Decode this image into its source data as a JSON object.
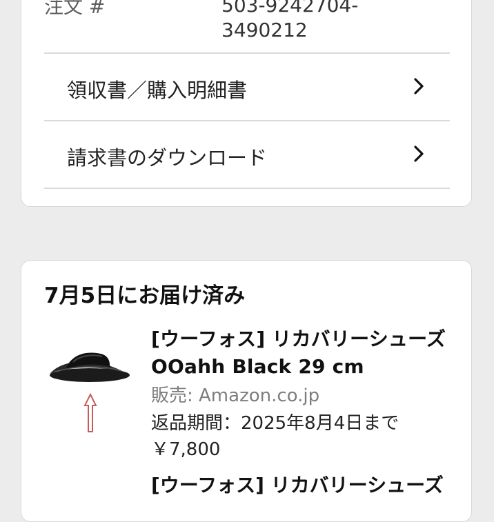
{
  "order": {
    "label": "注文 #",
    "number_line1": "503-9242704-",
    "number_line2": "3490212"
  },
  "menu": [
    {
      "label": "領収書／購入明細書",
      "icon": "chevron-right-icon"
    },
    {
      "label": "請求書のダウンロード",
      "icon": "chevron-right-icon"
    }
  ],
  "delivery": {
    "title": "7月5日にお届け済み",
    "items": [
      {
        "title": "[ウーフォス] リカバリーシューズ OOahh Black 29 cm",
        "seller": "販売: Amazon.co.jp",
        "return_period": "返品期間：2025年8月4日まで",
        "price": "￥7,800",
        "image": "black-slide-sandal-image",
        "annotation": "up-arrow-icon"
      },
      {
        "title": "[ウーフォス] リカバリーシューズ"
      }
    ]
  },
  "colors": {
    "background": "#ececec",
    "card": "#ffffff",
    "border": "#d7d7d7",
    "divider": "#dadada",
    "seller_gray": "#7d7d7d",
    "annotation_red": "#c85a5a"
  }
}
